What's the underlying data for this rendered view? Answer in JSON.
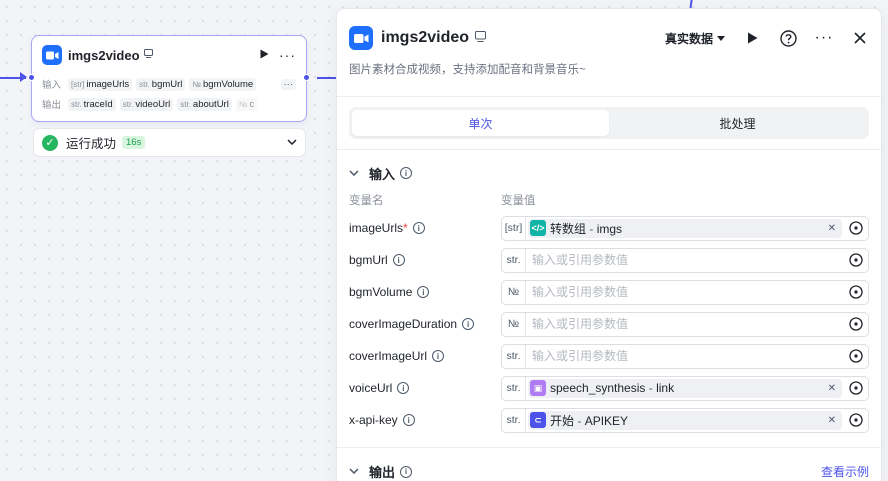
{
  "node": {
    "title": "imgs2video",
    "input_label": "输入",
    "output_label": "输出",
    "inputs": [
      {
        "type": "[str]",
        "name": "imageUrls"
      },
      {
        "type": "str.",
        "name": "bgmUrl"
      },
      {
        "type": "№",
        "name": "bgmVolume"
      }
    ],
    "outputs": [
      {
        "type": "str.",
        "name": "traceId"
      },
      {
        "type": "str.",
        "name": "videoUrl"
      },
      {
        "type": "str.",
        "name": "aboutUrl"
      },
      {
        "type": "№",
        "name": "c"
      }
    ],
    "more": "···",
    "status_text": "运行成功",
    "status_time": "16s"
  },
  "panel": {
    "title": "imgs2video",
    "data_select": "真实数据",
    "description": "图片素材合成视频，支持添加配音和背景音乐~",
    "tabs": [
      "单次",
      "批处理"
    ],
    "input_section": "输入",
    "col_name": "变量名",
    "col_value": "变量值",
    "variables": [
      {
        "name": "imageUrls",
        "required": true,
        "type": "[str]",
        "ref_icon": "</>",
        "ref_icon_color": "#12b4a7",
        "ref_source": "转数组",
        "ref_var": "imgs"
      },
      {
        "name": "bgmUrl",
        "required": false,
        "type": "str.",
        "placeholder": "输入或引用参数值"
      },
      {
        "name": "bgmVolume",
        "required": false,
        "type": "№",
        "placeholder": "输入或引用参数值"
      },
      {
        "name": "coverImageDuration",
        "required": false,
        "type": "№",
        "placeholder": "输入或引用参数值"
      },
      {
        "name": "coverImageUrl",
        "required": false,
        "type": "str.",
        "placeholder": "输入或引用参数值"
      },
      {
        "name": "voiceUrl",
        "required": false,
        "type": "str.",
        "ref_icon": "▣",
        "ref_icon_color": "#b07cf2",
        "ref_source": "speech_synthesis",
        "ref_var": "link"
      },
      {
        "name": "x-api-key",
        "required": false,
        "type": "str.",
        "ref_icon": "⊂",
        "ref_icon_color": "#4d53e8",
        "ref_source": "开始",
        "ref_var": "APIKEY"
      }
    ],
    "output_section": "输出",
    "example_link": "查看示例"
  },
  "colors": {
    "accent": "#4d53e8",
    "app_icon": "#1f6fff",
    "success": "#27b660"
  }
}
